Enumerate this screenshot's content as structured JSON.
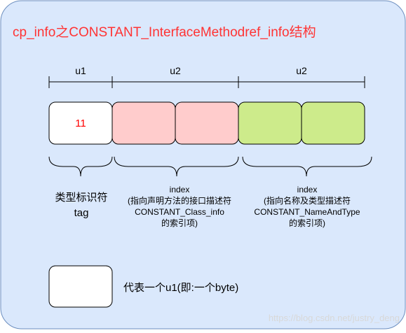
{
  "diagram": {
    "title": "cp_info之CONSTANT_InterfaceMethodref_info结构",
    "dimensions": [
      {
        "label": "u1"
      },
      {
        "label": "u2"
      },
      {
        "label": "u2"
      }
    ],
    "tag_value": "11",
    "colors": {
      "panel_fill": "#dae8fc",
      "panel_stroke": "#6c8ebf",
      "tag_fill": "#ffffff",
      "class_index_fill": "#ffcccc",
      "name_and_type_fill": "#cdeb8b",
      "title_color": "#ff3333",
      "tag_value_color": "#ff0000"
    },
    "descriptions": {
      "tag": {
        "line1": "类型标识符",
        "line2": "tag"
      },
      "class_index": {
        "line1": "index",
        "line2": "(指向声明方法的接口描述符",
        "line3": "CONSTANT_Class_info",
        "line4": "的索引项)"
      },
      "name_and_type_index": {
        "line1": "index",
        "line2": "(指向名称及类型描述符",
        "line3": "CONSTANT_NameAndType",
        "line4": "的索引项)"
      }
    },
    "legend": {
      "text": "代表一个u1(即:一个byte)"
    },
    "watermark": "https://blog.csdn.net/justry_deng"
  }
}
